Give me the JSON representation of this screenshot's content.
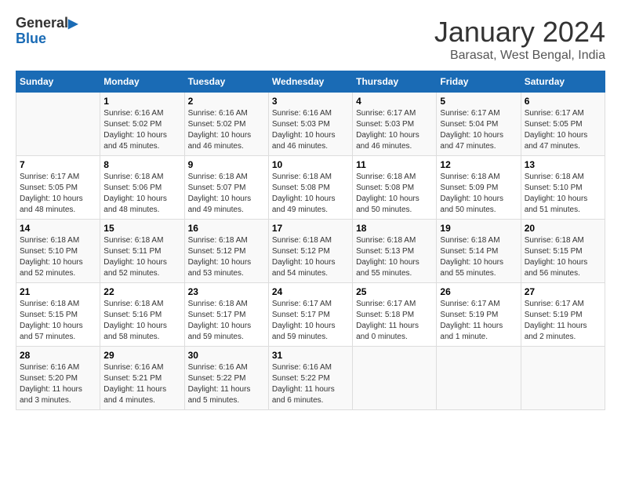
{
  "logo": {
    "line1": "General",
    "line2": "Blue"
  },
  "title": "January 2024",
  "location": "Barasat, West Bengal, India",
  "weekdays": [
    "Sunday",
    "Monday",
    "Tuesday",
    "Wednesday",
    "Thursday",
    "Friday",
    "Saturday"
  ],
  "weeks": [
    [
      {
        "day": "",
        "info": ""
      },
      {
        "day": "1",
        "info": "Sunrise: 6:16 AM\nSunset: 5:02 PM\nDaylight: 10 hours\nand 45 minutes."
      },
      {
        "day": "2",
        "info": "Sunrise: 6:16 AM\nSunset: 5:02 PM\nDaylight: 10 hours\nand 46 minutes."
      },
      {
        "day": "3",
        "info": "Sunrise: 6:16 AM\nSunset: 5:03 PM\nDaylight: 10 hours\nand 46 minutes."
      },
      {
        "day": "4",
        "info": "Sunrise: 6:17 AM\nSunset: 5:03 PM\nDaylight: 10 hours\nand 46 minutes."
      },
      {
        "day": "5",
        "info": "Sunrise: 6:17 AM\nSunset: 5:04 PM\nDaylight: 10 hours\nand 47 minutes."
      },
      {
        "day": "6",
        "info": "Sunrise: 6:17 AM\nSunset: 5:05 PM\nDaylight: 10 hours\nand 47 minutes."
      }
    ],
    [
      {
        "day": "7",
        "info": "Sunrise: 6:17 AM\nSunset: 5:05 PM\nDaylight: 10 hours\nand 48 minutes."
      },
      {
        "day": "8",
        "info": "Sunrise: 6:18 AM\nSunset: 5:06 PM\nDaylight: 10 hours\nand 48 minutes."
      },
      {
        "day": "9",
        "info": "Sunrise: 6:18 AM\nSunset: 5:07 PM\nDaylight: 10 hours\nand 49 minutes."
      },
      {
        "day": "10",
        "info": "Sunrise: 6:18 AM\nSunset: 5:08 PM\nDaylight: 10 hours\nand 49 minutes."
      },
      {
        "day": "11",
        "info": "Sunrise: 6:18 AM\nSunset: 5:08 PM\nDaylight: 10 hours\nand 50 minutes."
      },
      {
        "day": "12",
        "info": "Sunrise: 6:18 AM\nSunset: 5:09 PM\nDaylight: 10 hours\nand 50 minutes."
      },
      {
        "day": "13",
        "info": "Sunrise: 6:18 AM\nSunset: 5:10 PM\nDaylight: 10 hours\nand 51 minutes."
      }
    ],
    [
      {
        "day": "14",
        "info": "Sunrise: 6:18 AM\nSunset: 5:10 PM\nDaylight: 10 hours\nand 52 minutes."
      },
      {
        "day": "15",
        "info": "Sunrise: 6:18 AM\nSunset: 5:11 PM\nDaylight: 10 hours\nand 52 minutes."
      },
      {
        "day": "16",
        "info": "Sunrise: 6:18 AM\nSunset: 5:12 PM\nDaylight: 10 hours\nand 53 minutes."
      },
      {
        "day": "17",
        "info": "Sunrise: 6:18 AM\nSunset: 5:12 PM\nDaylight: 10 hours\nand 54 minutes."
      },
      {
        "day": "18",
        "info": "Sunrise: 6:18 AM\nSunset: 5:13 PM\nDaylight: 10 hours\nand 55 minutes."
      },
      {
        "day": "19",
        "info": "Sunrise: 6:18 AM\nSunset: 5:14 PM\nDaylight: 10 hours\nand 55 minutes."
      },
      {
        "day": "20",
        "info": "Sunrise: 6:18 AM\nSunset: 5:15 PM\nDaylight: 10 hours\nand 56 minutes."
      }
    ],
    [
      {
        "day": "21",
        "info": "Sunrise: 6:18 AM\nSunset: 5:15 PM\nDaylight: 10 hours\nand 57 minutes."
      },
      {
        "day": "22",
        "info": "Sunrise: 6:18 AM\nSunset: 5:16 PM\nDaylight: 10 hours\nand 58 minutes."
      },
      {
        "day": "23",
        "info": "Sunrise: 6:18 AM\nSunset: 5:17 PM\nDaylight: 10 hours\nand 59 minutes."
      },
      {
        "day": "24",
        "info": "Sunrise: 6:17 AM\nSunset: 5:17 PM\nDaylight: 10 hours\nand 59 minutes."
      },
      {
        "day": "25",
        "info": "Sunrise: 6:17 AM\nSunset: 5:18 PM\nDaylight: 11 hours\nand 0 minutes."
      },
      {
        "day": "26",
        "info": "Sunrise: 6:17 AM\nSunset: 5:19 PM\nDaylight: 11 hours\nand 1 minute."
      },
      {
        "day": "27",
        "info": "Sunrise: 6:17 AM\nSunset: 5:19 PM\nDaylight: 11 hours\nand 2 minutes."
      }
    ],
    [
      {
        "day": "28",
        "info": "Sunrise: 6:16 AM\nSunset: 5:20 PM\nDaylight: 11 hours\nand 3 minutes."
      },
      {
        "day": "29",
        "info": "Sunrise: 6:16 AM\nSunset: 5:21 PM\nDaylight: 11 hours\nand 4 minutes."
      },
      {
        "day": "30",
        "info": "Sunrise: 6:16 AM\nSunset: 5:22 PM\nDaylight: 11 hours\nand 5 minutes."
      },
      {
        "day": "31",
        "info": "Sunrise: 6:16 AM\nSunset: 5:22 PM\nDaylight: 11 hours\nand 6 minutes."
      },
      {
        "day": "",
        "info": ""
      },
      {
        "day": "",
        "info": ""
      },
      {
        "day": "",
        "info": ""
      }
    ]
  ]
}
